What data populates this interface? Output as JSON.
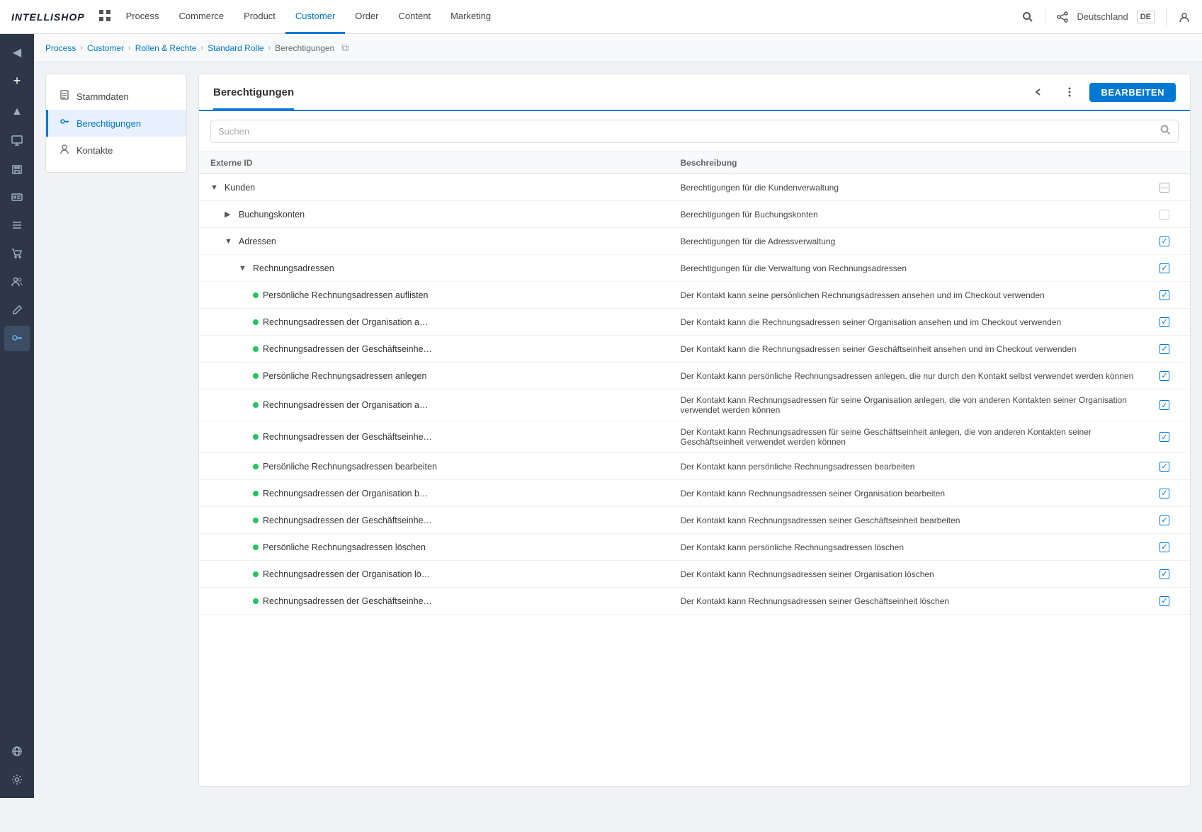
{
  "app": {
    "logo": "INTELLISHOP"
  },
  "topnav": {
    "items": [
      {
        "label": "Process",
        "active": false
      },
      {
        "label": "Commerce",
        "active": false
      },
      {
        "label": "Product",
        "active": false
      },
      {
        "label": "Customer",
        "active": true
      },
      {
        "label": "Order",
        "active": false
      },
      {
        "label": "Content",
        "active": false
      },
      {
        "label": "Marketing",
        "active": false
      }
    ],
    "lang": "Deutschland",
    "langCode": "DE"
  },
  "breadcrumb": {
    "items": [
      {
        "label": "Process",
        "link": true
      },
      {
        "label": "Customer",
        "link": true
      },
      {
        "label": "Rollen & Rechte",
        "link": true
      },
      {
        "label": "Standard Rolle",
        "link": true
      },
      {
        "label": "Berechtigungen",
        "link": false
      }
    ]
  },
  "sidenav": {
    "items": [
      {
        "label": "Stammdaten",
        "icon": "📋",
        "active": false
      },
      {
        "label": "Berechtigungen",
        "icon": "🔑",
        "active": true
      },
      {
        "label": "Kontakte",
        "icon": "👤",
        "active": false
      }
    ]
  },
  "panel": {
    "title": "Berechtigungen",
    "editButton": "BEARBEITEN",
    "searchPlaceholder": "Suchen",
    "table": {
      "columns": [
        "Externe ID",
        "Beschreibung"
      ],
      "rows": [
        {
          "id": "kunden",
          "indent": 0,
          "type": "group",
          "expanded": true,
          "name": "Kunden",
          "desc": "Berechtigungen für die Kundenverwaltung",
          "check": "indeterminate"
        },
        {
          "id": "buchungskonten",
          "indent": 1,
          "type": "group",
          "expanded": false,
          "name": "Buchungskonten",
          "desc": "Berechtigungen für Buchungskonten",
          "check": "empty"
        },
        {
          "id": "adressen",
          "indent": 1,
          "type": "group",
          "expanded": true,
          "name": "Adressen",
          "desc": "Berechtigungen für die Adressverwaltung",
          "check": "checked"
        },
        {
          "id": "rechnungsadressen",
          "indent": 2,
          "type": "group",
          "expanded": true,
          "name": "Rechnungsadressen",
          "desc": "Berechtigungen für die Verwaltung von Rechnungsadressen",
          "check": "checked"
        },
        {
          "id": "pers-rech-auflisten",
          "indent": 3,
          "type": "item",
          "name": "Persönliche Rechnungsadressen auflisten",
          "desc": "Der Kontakt kann seine persönlichen Rechnungsadressen ansehen und im Checkout verwenden",
          "check": "checked"
        },
        {
          "id": "org-rech-auflisten",
          "indent": 3,
          "type": "item",
          "name": "Rechnungsadressen der Organisation auflis...",
          "desc": "Der Kontakt kann die Rechnungsadressen seiner Organisation ansehen und im Checkout verwenden",
          "check": "checked"
        },
        {
          "id": "ge-rech-auflisten",
          "indent": 3,
          "type": "item",
          "name": "Rechnungsadressen der Geschäftseinheit a...",
          "desc": "Der Kontakt kann die Rechnungsadressen seiner Geschäftseinheit ansehen und im Checkout verwenden",
          "check": "checked"
        },
        {
          "id": "pers-rech-anlegen",
          "indent": 3,
          "type": "item",
          "name": "Persönliche Rechnungsadressen anlegen",
          "desc": "Der Kontakt kann persönliche Rechnungsadressen anlegen, die nur durch den Kontakt selbst verwendet werden können",
          "check": "checked"
        },
        {
          "id": "org-rech-anlegen",
          "indent": 3,
          "type": "item",
          "name": "Rechnungsadressen der Organisation anleg...",
          "desc": "Der Kontakt kann Rechnungsadressen für seine Organisation anlegen, die von anderen Kontakten seiner Organisation verwendet werden können",
          "check": "checked"
        },
        {
          "id": "ge-rech-anlegen",
          "indent": 3,
          "type": "item",
          "name": "Rechnungsadressen der Geschäftseinheit a...",
          "desc": "Der Kontakt kann Rechnungsadressen für seine Geschäftseinheit anlegen, die von anderen Kontakten seiner Geschäftseinheit verwendet werden können",
          "check": "checked"
        },
        {
          "id": "pers-rech-bearbeiten",
          "indent": 3,
          "type": "item",
          "name": "Persönliche Rechnungsadressen bearbeiten",
          "desc": "Der Kontakt kann persönliche Rechnungsadressen bearbeiten",
          "check": "checked"
        },
        {
          "id": "org-rech-bearbeiten",
          "indent": 3,
          "type": "item",
          "name": "Rechnungsadressen der Organisation beart...",
          "desc": "Der Kontakt kann Rechnungsadressen seiner Organisation bearbeiten",
          "check": "checked"
        },
        {
          "id": "ge-rech-bearbeiten",
          "indent": 3,
          "type": "item",
          "name": "Rechnungsadressen der Geschäftseinheit b...",
          "desc": "Der Kontakt kann Rechnungsadressen seiner Geschäftseinheit bearbeiten",
          "check": "checked"
        },
        {
          "id": "pers-rech-loeschen",
          "indent": 3,
          "type": "item",
          "name": "Persönliche Rechnungsadressen löschen",
          "desc": "Der Kontakt kann persönliche Rechnungsadressen löschen",
          "check": "checked"
        },
        {
          "id": "org-rech-loeschen",
          "indent": 3,
          "type": "item",
          "name": "Rechnungsadressen der Organisation lösch...",
          "desc": "Der Kontakt kann Rechnungsadressen seiner Organisation löschen",
          "check": "checked"
        },
        {
          "id": "ge-rech-loeschen",
          "indent": 3,
          "type": "item",
          "name": "Rechnungsadressen der Geschäftseinheit lö...",
          "desc": "Der Kontakt kann Rechnungsadressen seiner Geschäftseinheit löschen",
          "check": "checked"
        }
      ]
    }
  },
  "leftsidebar": {
    "icons": [
      {
        "name": "collapse-icon",
        "symbol": "◀",
        "active": false
      },
      {
        "name": "add-icon",
        "symbol": "+",
        "active": false
      },
      {
        "name": "chevron-up-icon",
        "symbol": "▲",
        "active": false
      },
      {
        "name": "monitor-icon",
        "symbol": "🖥",
        "active": false
      },
      {
        "name": "building-icon",
        "symbol": "🏛",
        "active": false
      },
      {
        "name": "id-card-icon",
        "symbol": "🪪",
        "active": false
      },
      {
        "name": "list-icon",
        "symbol": "☰",
        "active": false
      },
      {
        "name": "cart-icon",
        "symbol": "🛒",
        "active": false
      },
      {
        "name": "group-icon",
        "symbol": "👥",
        "active": false
      },
      {
        "name": "edit-icon",
        "symbol": "✏",
        "active": false
      },
      {
        "name": "key-icon",
        "symbol": "🔑",
        "active": true
      },
      {
        "name": "globe-icon",
        "symbol": "🌐",
        "active": false
      },
      {
        "name": "settings-icon",
        "symbol": "⚙",
        "active": false
      }
    ]
  }
}
